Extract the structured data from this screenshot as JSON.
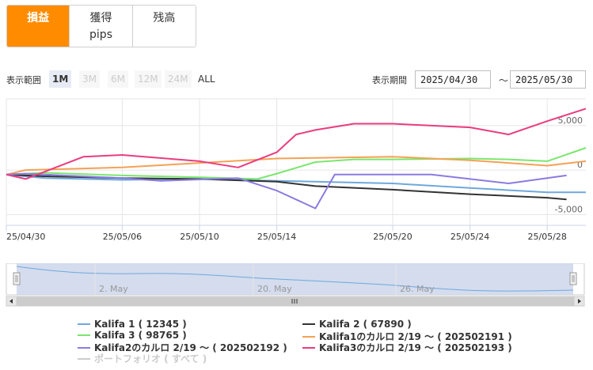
{
  "tabs": [
    {
      "label": "損益",
      "sub": "",
      "active": true
    },
    {
      "label": "獲得",
      "sub": "pips",
      "active": false
    },
    {
      "label": "残高",
      "sub": "",
      "active": false
    }
  ],
  "range": {
    "label": "表示範囲",
    "buttons": [
      "1M",
      "3M",
      "6M",
      "12M",
      "24M",
      "ALL"
    ]
  },
  "period": {
    "label": "表示期間",
    "from": "2025/04/30",
    "to": "2025/05/30",
    "separator": "～"
  },
  "navigator_labels": [
    "2. May",
    "20. May",
    "26. May"
  ],
  "legend": [
    {
      "name": "Kalifa 1 ( 12345 )",
      "color": "#6fa8dc",
      "visible": true
    },
    {
      "name": "Kalifa 2 ( 67890 )",
      "color": "#333333",
      "visible": true
    },
    {
      "name": "Kalifa 3 ( 98765 )",
      "color": "#7ce66f",
      "visible": true
    },
    {
      "name": "Kalifa1のカルロ 2/19 ～ ( 202502191 )",
      "color": "#f4a155",
      "visible": true
    },
    {
      "name": "Kalifa2のカルロ 2/19 ～ ( 202502192 )",
      "color": "#8a7be0",
      "visible": true
    },
    {
      "name": "Kalifa3のカルロ 2/19 ～ ( 202502193 )",
      "color": "#ea3c7e",
      "visible": true
    },
    {
      "name": "ポートフォリオ ( すべて )",
      "color": "#cccccc",
      "visible": false
    }
  ],
  "chart_data": {
    "type": "line",
    "x_ticks": [
      "25/04/30",
      "25/05/06",
      "25/05/10",
      "25/05/14",
      "25/05/20",
      "25/05/24",
      "25/05/28"
    ],
    "y_ticks": [
      5000,
      0,
      -5000
    ],
    "y_tick_labels": [
      "5,000",
      "0",
      "-5,000"
    ],
    "xlim": [
      "2025-04-30",
      "2025-05-30"
    ],
    "ylim": [
      -6200,
      8000
    ],
    "grid": true,
    "legend_position": "bottom",
    "series": [
      {
        "name": "Kalifa 1 ( 12345 )",
        "color": "#6fa8dc",
        "x": [
          "2025-04-30",
          "2025-05-02",
          "2025-05-06",
          "2025-05-10",
          "2025-05-14",
          "2025-05-20",
          "2025-05-24",
          "2025-05-28",
          "2025-05-30"
        ],
        "y": [
          -500,
          -900,
          -1100,
          -1000,
          -1200,
          -1500,
          -2000,
          -2500,
          -2500
        ]
      },
      {
        "name": "Kalifa 2 ( 67890 )",
        "color": "#333333",
        "x": [
          "2025-04-30",
          "2025-05-02",
          "2025-05-06",
          "2025-05-10",
          "2025-05-14",
          "2025-05-16",
          "2025-05-20",
          "2025-05-24",
          "2025-05-28",
          "2025-05-29"
        ],
        "y": [
          -500,
          -700,
          -900,
          -1000,
          -1300,
          -1800,
          -2200,
          -2700,
          -3100,
          -3300
        ]
      },
      {
        "name": "Kalifa 3 ( 98765 )",
        "color": "#7ce66f",
        "x": [
          "2025-04-30",
          "2025-05-02",
          "2025-05-06",
          "2025-05-10",
          "2025-05-13",
          "2025-05-14",
          "2025-05-16",
          "2025-05-18",
          "2025-05-20",
          "2025-05-24",
          "2025-05-26",
          "2025-05-28",
          "2025-05-30"
        ],
        "y": [
          -500,
          -300,
          -600,
          -800,
          -1000,
          -400,
          900,
          1200,
          1200,
          1300,
          1200,
          1000,
          2500
        ]
      },
      {
        "name": "Kalifa1のカルロ 2/19 ～ ( 202502191 )",
        "color": "#f4a155",
        "x": [
          "2025-04-30",
          "2025-05-01",
          "2025-05-06",
          "2025-05-10",
          "2025-05-14",
          "2025-05-20",
          "2025-05-24",
          "2025-05-28",
          "2025-05-30"
        ],
        "y": [
          -500,
          0,
          300,
          800,
          1300,
          1500,
          1100,
          500,
          1000
        ]
      },
      {
        "name": "Kalifa2のカルロ 2/19 ～ ( 202502192 )",
        "color": "#8a7be0",
        "x": [
          "2025-04-30",
          "2025-05-01",
          "2025-05-06",
          "2025-05-08",
          "2025-05-12",
          "2025-05-14",
          "2025-05-16",
          "2025-05-17",
          "2025-05-22",
          "2025-05-26",
          "2025-05-28",
          "2025-05-29"
        ],
        "y": [
          -500,
          -400,
          -900,
          -1200,
          -900,
          -2300,
          -4300,
          -500,
          -500,
          -1500,
          -900,
          -600
        ]
      },
      {
        "name": "Kalifa3のカルロ 2/19 ～ ( 202502193 )",
        "color": "#ea3c7e",
        "x": [
          "2025-04-30",
          "2025-05-01",
          "2025-05-04",
          "2025-05-06",
          "2025-05-10",
          "2025-05-12",
          "2025-05-14",
          "2025-05-15",
          "2025-05-16",
          "2025-05-18",
          "2025-05-20",
          "2025-05-24",
          "2025-05-26",
          "2025-05-28",
          "2025-05-30"
        ],
        "y": [
          -500,
          -1000,
          1500,
          1700,
          1000,
          300,
          2000,
          4000,
          4500,
          5200,
          5200,
          4800,
          4000,
          5500,
          6900
        ]
      }
    ]
  }
}
